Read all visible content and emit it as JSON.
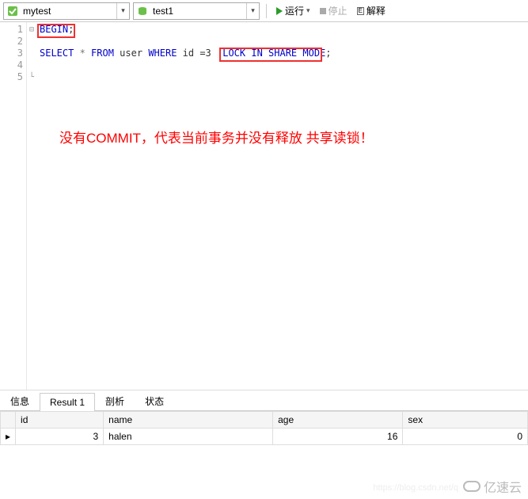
{
  "toolbar": {
    "database": "mytest",
    "table": "test1",
    "run_label": "运行",
    "stop_label": "停止",
    "explain_label": "解释"
  },
  "editor": {
    "line_numbers": [
      "1",
      "2",
      "3",
      "4",
      "5"
    ],
    "fold_marks": [
      "⊟",
      "",
      "",
      "",
      "└"
    ],
    "code": {
      "l1_begin": "BEGIN",
      "l1_semi": ";",
      "l3_select": "SELECT",
      "l3_star": " * ",
      "l3_from": "FROM",
      "l3_user": " user ",
      "l3_where": "WHERE",
      "l3_cond": " id =3  ",
      "l3_lock": "LOCK IN SHARE MODE",
      "l3_semi": ";"
    },
    "annotation": "没有COMMIT，代表当前事务并没有释放 共享读锁！"
  },
  "result_tabs": {
    "info": "信息",
    "result1": "Result 1",
    "profile": "剖析",
    "status": "状态"
  },
  "result": {
    "columns": [
      "id",
      "name",
      "age",
      "sex"
    ],
    "rows": [
      {
        "id": "3",
        "name": "halen",
        "age": "16",
        "sex": "0"
      }
    ]
  },
  "watermark": {
    "csdn": "https://blog.csdn.net/q",
    "brand": "亿速云"
  }
}
